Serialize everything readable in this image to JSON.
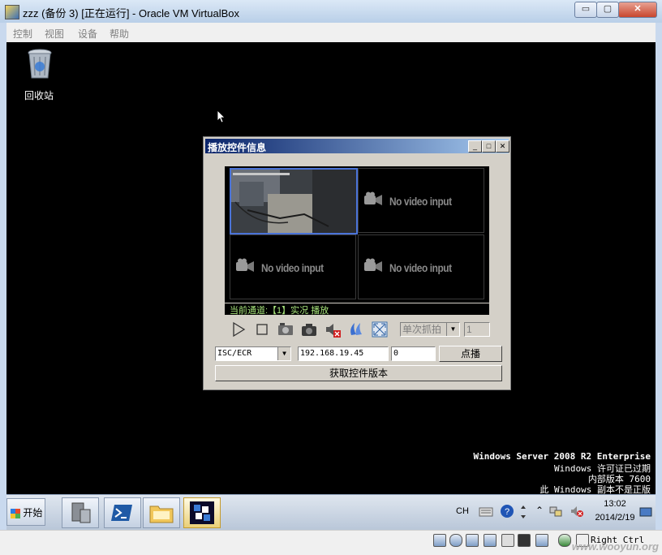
{
  "host_window": {
    "title": "zzz (备份 3) [正在运行] - Oracle VM VirtualBox",
    "min_label": "▭",
    "max_label": "▢",
    "close_label": "✕",
    "menu": [
      "控制",
      "视图",
      "设备",
      "帮助"
    ]
  },
  "desktop": {
    "recycle_bin_label": "回收站",
    "watermark_lines": [
      "Windows Server 2008 R2 Enterprise",
      "Windows 许可证已过期",
      "内部版本 7600",
      "此 Windows 副本不是正版"
    ]
  },
  "dialog": {
    "title": "播放控件信息",
    "no_video_text": "No video input",
    "status_text": "当前通道:【1】实况 播放",
    "capture_mode": "单次抓拍",
    "capture_count": "1",
    "protocol": "ISC/ECR",
    "ip_address": "192.168.19.45",
    "port": "0",
    "play_button": "点播",
    "version_button": "获取控件版本"
  },
  "taskbar": {
    "start_label": "开始",
    "lang": "CH",
    "time": "13:02",
    "date": "2014/2/19"
  },
  "vbox_status": {
    "host_key": "Right Ctrl",
    "site_watermark": "www.wooyun.org"
  }
}
